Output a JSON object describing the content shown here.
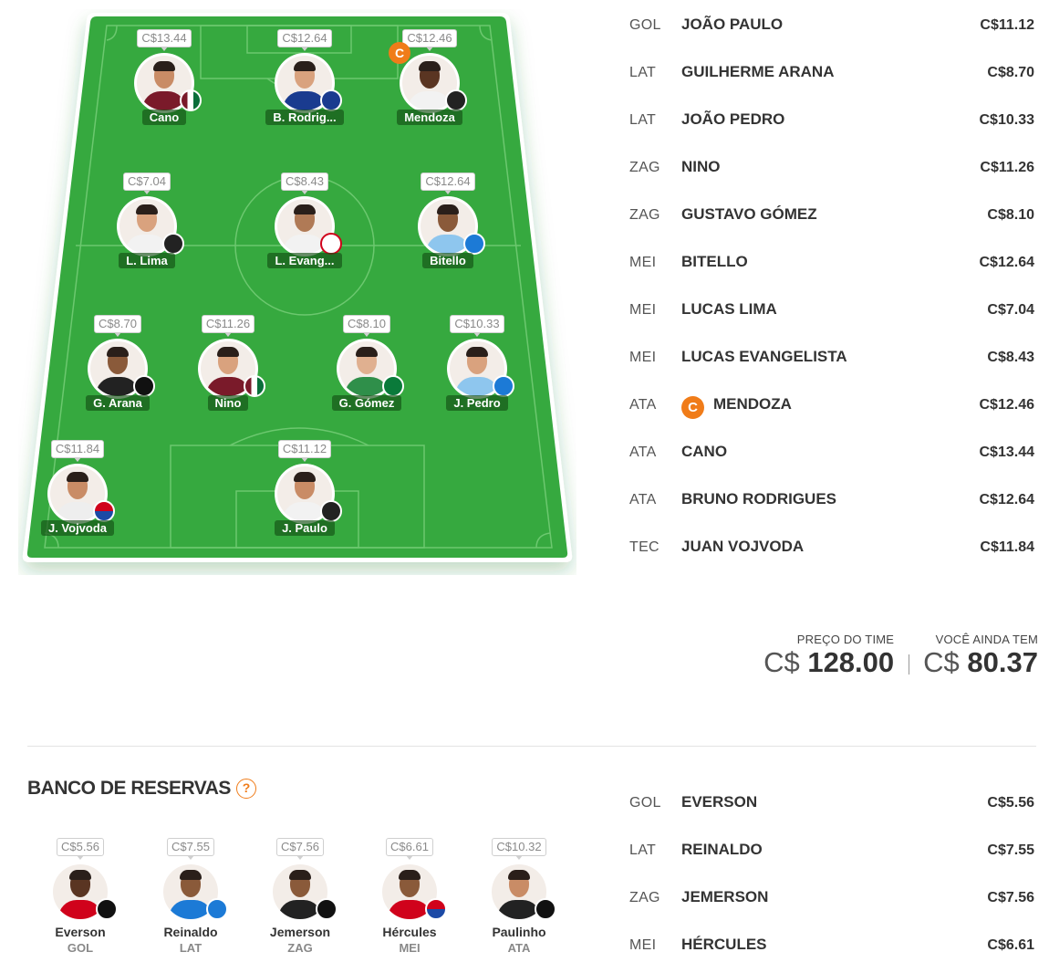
{
  "field_players": [
    {
      "short": "Cano",
      "price": "C$13.44",
      "club": "flu",
      "skin": "#c98c66",
      "shirt": "#7a1a2a"
    },
    {
      "short": "B. Rodrig...",
      "price": "C$12.64",
      "club": "cru",
      "skin": "#d9a27e",
      "shirt": "#1a3b8f"
    },
    {
      "short": "Mendoza",
      "price": "C$12.46",
      "club": "san",
      "skin": "#5a3522",
      "shirt": "#f2f2f2",
      "captain": "C"
    },
    {
      "short": "L. Lima",
      "price": "C$7.04",
      "club": "san",
      "skin": "#d9a27e",
      "shirt": "#f2f2f2"
    },
    {
      "short": "L. Evang...",
      "price": "C$8.43",
      "club": "rbb",
      "skin": "#b07a56",
      "shirt": "#f2f2f2"
    },
    {
      "short": "Bitello",
      "price": "C$12.64",
      "club": "gre",
      "skin": "#8a5a3a",
      "shirt": "#8ec6ee"
    },
    {
      "short": "G. Arana",
      "price": "C$8.70",
      "club": "cam",
      "skin": "#8a5a3a",
      "shirt": "#222222"
    },
    {
      "short": "Nino",
      "price": "C$11.26",
      "club": "flu",
      "skin": "#d9a27e",
      "shirt": "#7a1a2a"
    },
    {
      "short": "G. Gómez",
      "price": "C$8.10",
      "club": "pal",
      "skin": "#e0b090",
      "shirt": "#2f8f4a"
    },
    {
      "short": "J. Pedro",
      "price": "C$10.33",
      "club": "gre",
      "skin": "#d9a27e",
      "shirt": "#8ec6ee"
    },
    {
      "short": "J. Vojvoda",
      "price": "C$11.84",
      "club": "for",
      "skin": "#c98c66",
      "shirt": "#eeeeee"
    },
    {
      "short": "J. Paulo",
      "price": "C$11.12",
      "club": "san",
      "skin": "#c98c66",
      "shirt": "#f2f2f2"
    }
  ],
  "lineup": [
    {
      "pos": "GOL",
      "name": "JOÃO PAULO",
      "price": "C$11.12"
    },
    {
      "pos": "LAT",
      "name": "GUILHERME ARANA",
      "price": "C$8.70"
    },
    {
      "pos": "LAT",
      "name": "JOÃO PEDRO",
      "price": "C$10.33"
    },
    {
      "pos": "ZAG",
      "name": "NINO",
      "price": "C$11.26"
    },
    {
      "pos": "ZAG",
      "name": "GUSTAVO GÓMEZ",
      "price": "C$8.10"
    },
    {
      "pos": "MEI",
      "name": "BITELLO",
      "price": "C$12.64"
    },
    {
      "pos": "MEI",
      "name": "LUCAS LIMA",
      "price": "C$7.04"
    },
    {
      "pos": "MEI",
      "name": "LUCAS EVANGELISTA",
      "price": "C$8.43"
    },
    {
      "pos": "ATA",
      "name": "MENDOZA",
      "price": "C$12.46",
      "captain": "C"
    },
    {
      "pos": "ATA",
      "name": "CANO",
      "price": "C$13.44"
    },
    {
      "pos": "ATA",
      "name": "BRUNO RODRIGUES",
      "price": "C$12.64"
    },
    {
      "pos": "TEC",
      "name": "JUAN VOJVODA",
      "price": "C$11.84"
    }
  ],
  "summary": {
    "team_price_label": "PREÇO DO TIME",
    "team_price_currency": "C$",
    "team_price_value": "128.00",
    "remaining_label": "VOCÊ AINDA TEM",
    "remaining_currency": "C$",
    "remaining_value": "80.37"
  },
  "bench": {
    "title": "BANCO DE RESERVAS",
    "help_icon": "?",
    "players": [
      {
        "name": "Everson",
        "pos": "GOL",
        "price": "C$5.56",
        "club": "cam",
        "skin": "#5a3522",
        "shirt": "#d0021b"
      },
      {
        "name": "Reinaldo",
        "pos": "LAT",
        "price": "C$7.55",
        "club": "gre",
        "skin": "#8a5a3a",
        "shirt": "#1c7ad6"
      },
      {
        "name": "Jemerson",
        "pos": "ZAG",
        "price": "C$7.56",
        "club": "cam",
        "skin": "#8a5a3a",
        "shirt": "#222222"
      },
      {
        "name": "Hércules",
        "pos": "MEI",
        "price": "C$6.61",
        "club": "for",
        "skin": "#8a5a3a",
        "shirt": "#d0021b"
      },
      {
        "name": "Paulinho",
        "pos": "ATA",
        "price": "C$10.32",
        "club": "cam",
        "skin": "#c98c66",
        "shirt": "#222222"
      }
    ],
    "list": [
      {
        "pos": "GOL",
        "name": "EVERSON",
        "price": "C$5.56"
      },
      {
        "pos": "LAT",
        "name": "REINALDO",
        "price": "C$7.55"
      },
      {
        "pos": "ZAG",
        "name": "JEMERSON",
        "price": "C$7.56"
      },
      {
        "pos": "MEI",
        "name": "HÉRCULES",
        "price": "C$6.61"
      }
    ]
  },
  "colors": {
    "field_green": "#36a93f",
    "captain_orange": "#f07c19"
  }
}
